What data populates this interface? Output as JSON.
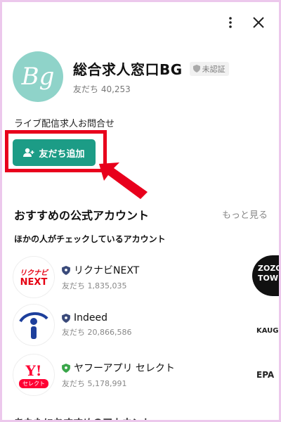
{
  "header": {
    "more_icon": "more-vertical-icon",
    "close_icon": "close-icon"
  },
  "profile": {
    "avatar_text": "Bg",
    "name": "総合求人窓口BG",
    "badge_label": "未認証",
    "friends_label": "友だち 40,253",
    "description": "ライブ配信求人お問合せ",
    "add_friend_label": "友だち追加"
  },
  "colors": {
    "accent": "#1c9c86",
    "highlight": "#e8001c",
    "avatar_bg": "#8fd3c9",
    "frame": "#ecc8ec"
  },
  "recommended": {
    "title": "おすすめの公式アカウント",
    "more_label": "もっと見る",
    "subtitle": "ほかの人がチェックしているアカウント",
    "items": [
      {
        "name": "リクナビNEXT",
        "friends": "友だち 1,835,035",
        "logo_top": "リクナビ",
        "logo_bottom": "NEXT"
      },
      {
        "name": "Indeed",
        "friends": "友だち 20,866,586",
        "logo_text": "i"
      },
      {
        "name": "ヤフーアプリ セレクト",
        "friends": "友だち 5,178,991",
        "logo_top": "Y!",
        "logo_bottom": "セレクト"
      }
    ],
    "side_logos": [
      "ZOZO TOWN",
      "KAUG",
      "EPA"
    ]
  },
  "next_section_title": "あなたにおすすめのアカウント"
}
